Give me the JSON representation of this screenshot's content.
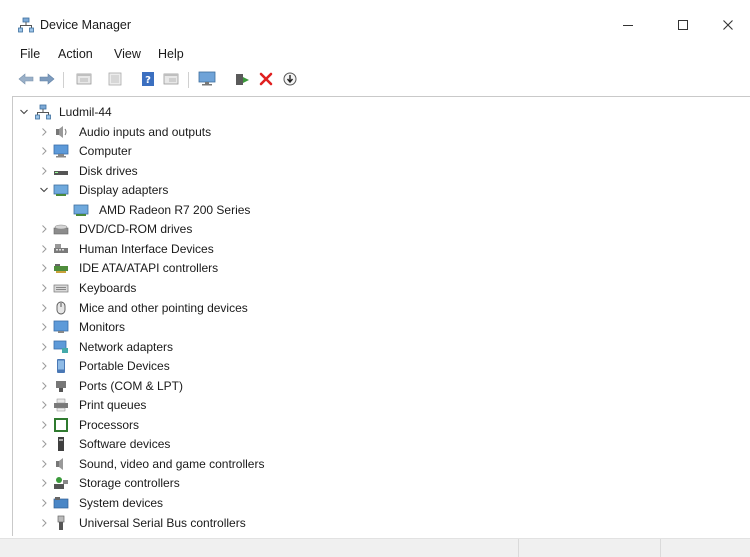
{
  "window": {
    "title": "Device Manager",
    "icon": "device-manager-icon",
    "controls": {
      "minimize": "minimize-icon",
      "maximize": "maximize-icon",
      "close": "close-icon"
    }
  },
  "menu": {
    "items": [
      "File",
      "Action",
      "View",
      "Help"
    ]
  },
  "toolbar": {
    "buttons": [
      "back-arrow-icon",
      "forward-arrow-icon",
      "properties-icon",
      "show-hide-tree-icon",
      "help-icon",
      "view-list-icon",
      "monitor-icon",
      "update-driver-icon",
      "uninstall-icon",
      "scan-hardware-icon"
    ]
  },
  "tree": {
    "root": {
      "label": "Ludmil-44",
      "expanded": true,
      "icon": "computer-root-icon"
    },
    "categories": [
      {
        "label": "Audio inputs and outputs",
        "icon": "audio-icon",
        "expanded": false
      },
      {
        "label": "Computer",
        "icon": "computer-icon",
        "expanded": false
      },
      {
        "label": "Disk drives",
        "icon": "disk-drive-icon",
        "expanded": false
      },
      {
        "label": "Display adapters",
        "icon": "display-adapter-icon",
        "expanded": true,
        "children": [
          {
            "label": "AMD Radeon R7 200 Series",
            "icon": "display-adapter-icon"
          }
        ]
      },
      {
        "label": "DVD/CD-ROM drives",
        "icon": "dvd-icon",
        "expanded": false
      },
      {
        "label": "Human Interface Devices",
        "icon": "hid-icon",
        "expanded": false
      },
      {
        "label": "IDE ATA/ATAPI controllers",
        "icon": "ide-icon",
        "expanded": false
      },
      {
        "label": "Keyboards",
        "icon": "keyboard-icon",
        "expanded": false
      },
      {
        "label": "Mice and other pointing devices",
        "icon": "mouse-icon",
        "expanded": false
      },
      {
        "label": "Monitors",
        "icon": "monitor-icon",
        "expanded": false
      },
      {
        "label": "Network adapters",
        "icon": "network-icon",
        "expanded": false
      },
      {
        "label": "Portable Devices",
        "icon": "portable-device-icon",
        "expanded": false
      },
      {
        "label": "Ports (COM & LPT)",
        "icon": "port-icon",
        "expanded": false
      },
      {
        "label": "Print queues",
        "icon": "printer-icon",
        "expanded": false
      },
      {
        "label": "Processors",
        "icon": "processor-icon",
        "expanded": false
      },
      {
        "label": "Software devices",
        "icon": "software-device-icon",
        "expanded": false
      },
      {
        "label": "Sound, video and game controllers",
        "icon": "sound-icon",
        "expanded": false
      },
      {
        "label": "Storage controllers",
        "icon": "storage-icon",
        "expanded": false
      },
      {
        "label": "System devices",
        "icon": "system-device-icon",
        "expanded": false
      },
      {
        "label": "Universal Serial Bus controllers",
        "icon": "usb-icon",
        "expanded": false
      }
    ]
  },
  "colors": {
    "accent_blue": "#2f7fd6",
    "uninstall_red": "#e02020",
    "driver_green": "#3a9a3a"
  }
}
